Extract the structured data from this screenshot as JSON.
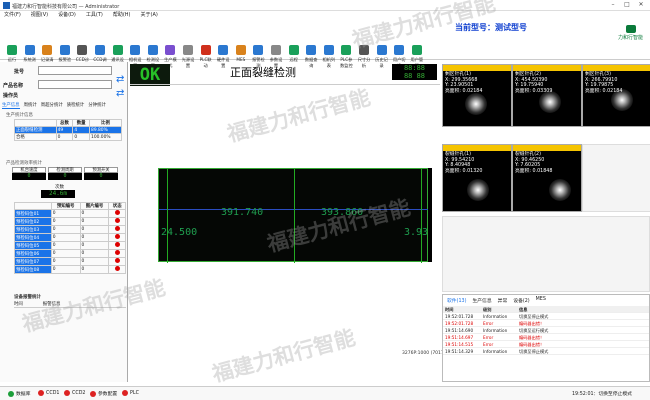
{
  "window": {
    "title": "福建力和行智能科技有限公司 — Administrator"
  },
  "menu": [
    "文件(F)",
    "视图(V)",
    "设备(D)",
    "工具(T)",
    "帮助(H)",
    "关于(A)"
  ],
  "toolbar": [
    {
      "label": "运行",
      "color": "#1aa05a"
    },
    {
      "label": "系统测试",
      "color": "#2b78d0"
    },
    {
      "label": "记录清空",
      "color": "#d9821c"
    },
    {
      "label": "报警验证",
      "color": "#2b78d0"
    },
    {
      "label": "CCD诊断",
      "color": "#555"
    },
    {
      "label": "CCD调零",
      "color": "#2b78d0"
    },
    {
      "label": "通讯设置",
      "color": "#1aa05a"
    },
    {
      "label": "相机设置",
      "color": "#2b78d0"
    },
    {
      "label": "检测设置",
      "color": "#2b78d0"
    },
    {
      "label": "生产模式",
      "color": "#7a4fcf"
    },
    {
      "label": "光源设置",
      "color": "#888"
    },
    {
      "label": "PLC联动",
      "color": "#d0301c"
    },
    {
      "label": "硬件设置",
      "color": "#2b78d0"
    },
    {
      "label": "MES",
      "color": "#d9821c"
    },
    {
      "label": "报警检测",
      "color": "#2b78d0"
    },
    {
      "label": "参数设置",
      "color": "#888"
    },
    {
      "label": "远程",
      "color": "#1aa05a"
    },
    {
      "label": "数据查询",
      "color": "#2b78d0"
    },
    {
      "label": "相机列表",
      "color": "#2b78d0"
    },
    {
      "label": "PLC参数监控",
      "color": "#1aa05a"
    },
    {
      "label": "尺寸分析",
      "color": "#555"
    },
    {
      "label": "历史记录",
      "color": "#2b78d0"
    },
    {
      "label": "用户切换",
      "color": "#2b78d0"
    },
    {
      "label": "用户管理",
      "color": "#1aa05a"
    }
  ],
  "current_model": "当前型号：测试型号",
  "logo": {
    "text": "力和行智能"
  },
  "left": {
    "batch_label": "批号",
    "product_label": "产品名称",
    "operator_label": "操作员",
    "tabs": [
      "生产信息",
      "周统计",
      "周超分统计",
      "质检统计",
      "分钟统计"
    ],
    "stats_title": "生产统计信息",
    "stats_headers": [
      "",
      "总数",
      "数量",
      "比例"
    ],
    "stats_rows": [
      {
        "name": "正面裂缝检测",
        "total": "49",
        "count": "4",
        "rate": "89.80%",
        "sel": true
      },
      {
        "name": "合格",
        "total": "0",
        "count": "0",
        "rate": "100.00%",
        "sel": false
      }
    ],
    "speed_title": "产品检测效率统计",
    "speed_labels": [
      "机台速度",
      "检测周期",
      "预测开关"
    ],
    "speed_values": [
      "0",
      "0",
      "0"
    ],
    "count_label": "次数",
    "count_value": "24.6m",
    "code_headers": [
      "",
      "预知编号",
      "图片编号",
      "状态"
    ],
    "codes": [
      {
        "name": "预检码位01",
        "a": "0",
        "b": "0"
      },
      {
        "name": "预检码位02",
        "a": "0",
        "b": "0"
      },
      {
        "name": "预检码位03",
        "a": "0",
        "b": "0"
      },
      {
        "name": "预检码位04",
        "a": "0",
        "b": "0"
      },
      {
        "name": "预检码位05",
        "a": "0",
        "b": "0"
      },
      {
        "name": "预检码位06",
        "a": "0",
        "b": "0"
      },
      {
        "name": "预检码位07",
        "a": "0",
        "b": "0"
      },
      {
        "name": "预检码位08",
        "a": "0",
        "b": "0"
      }
    ],
    "device_title": "设备报警统计",
    "device_headers": [
      "时间",
      "报警信息"
    ]
  },
  "center": {
    "result": "OK",
    "title": "正面裂缝检测",
    "lcd_top": "88:88",
    "lcd_bottom": "88 88",
    "values": [
      "391.740",
      "393.860",
      "24.500",
      "3.93"
    ],
    "coord": "3276P:1000 (7017,25492) 0"
  },
  "tiles": [
    {
      "title": "剩区针孔(1)",
      "x": "X: 299.35668",
      "y": "Y: 23.90501",
      "area": "亮面积: 0.02184"
    },
    {
      "title": "剩区针孔(2)",
      "x": "X: 454.50390",
      "y": "Y: 19.75940",
      "area": "亮面积: 0.03309"
    },
    {
      "title": "剩区针孔(3)",
      "x": "X: 266.79910",
      "y": "Y: 19.79875",
      "area": "亮面积: 0.02184"
    },
    {
      "title": "裂缝针孔(1)",
      "x": "X: 99.54210",
      "y": "Y: 8.40948",
      "area": "亮面积: 0.01320"
    },
    {
      "title": "裂缝针孔(2)",
      "x": "X: 90.46250",
      "y": "Y: 7.60205",
      "area": "亮面积: 0.01848"
    }
  ],
  "log": {
    "tabs": [
      "软件(13)",
      "生产信息",
      "异常",
      "设备(2)",
      "MES"
    ],
    "headers": [
      "时间",
      "级别",
      "信息"
    ],
    "rows": [
      {
        "t": "19:52:01.728",
        "lvl": "Information",
        "msg": "切换至停止模式",
        "err": false
      },
      {
        "t": "19:52:01.728",
        "lvl": "Error",
        "msg": "编码器出错！",
        "err": true
      },
      {
        "t": "19:51:14.690",
        "lvl": "Information",
        "msg": "切换至运行模式",
        "err": false
      },
      {
        "t": "19:51:14.697",
        "lvl": "Error",
        "msg": "编码器出错！",
        "err": true
      },
      {
        "t": "19:51:14.515",
        "lvl": "Error",
        "msg": "编码器出错！",
        "err": true
      },
      {
        "t": "19:51:14.329",
        "lvl": "Information",
        "msg": "切换至停止模式",
        "err": false
      }
    ]
  },
  "status": {
    "items": [
      {
        "label": "数据库",
        "ok": true
      },
      {
        "label": "CCD1",
        "ok": false
      },
      {
        "label": "CCD2",
        "ok": false
      },
      {
        "label": "参数配置",
        "ok": false
      },
      {
        "label": "PLC",
        "ok": false
      }
    ],
    "right": "19:52:01：切换至停止模式"
  },
  "watermark": "福建力和行智能"
}
